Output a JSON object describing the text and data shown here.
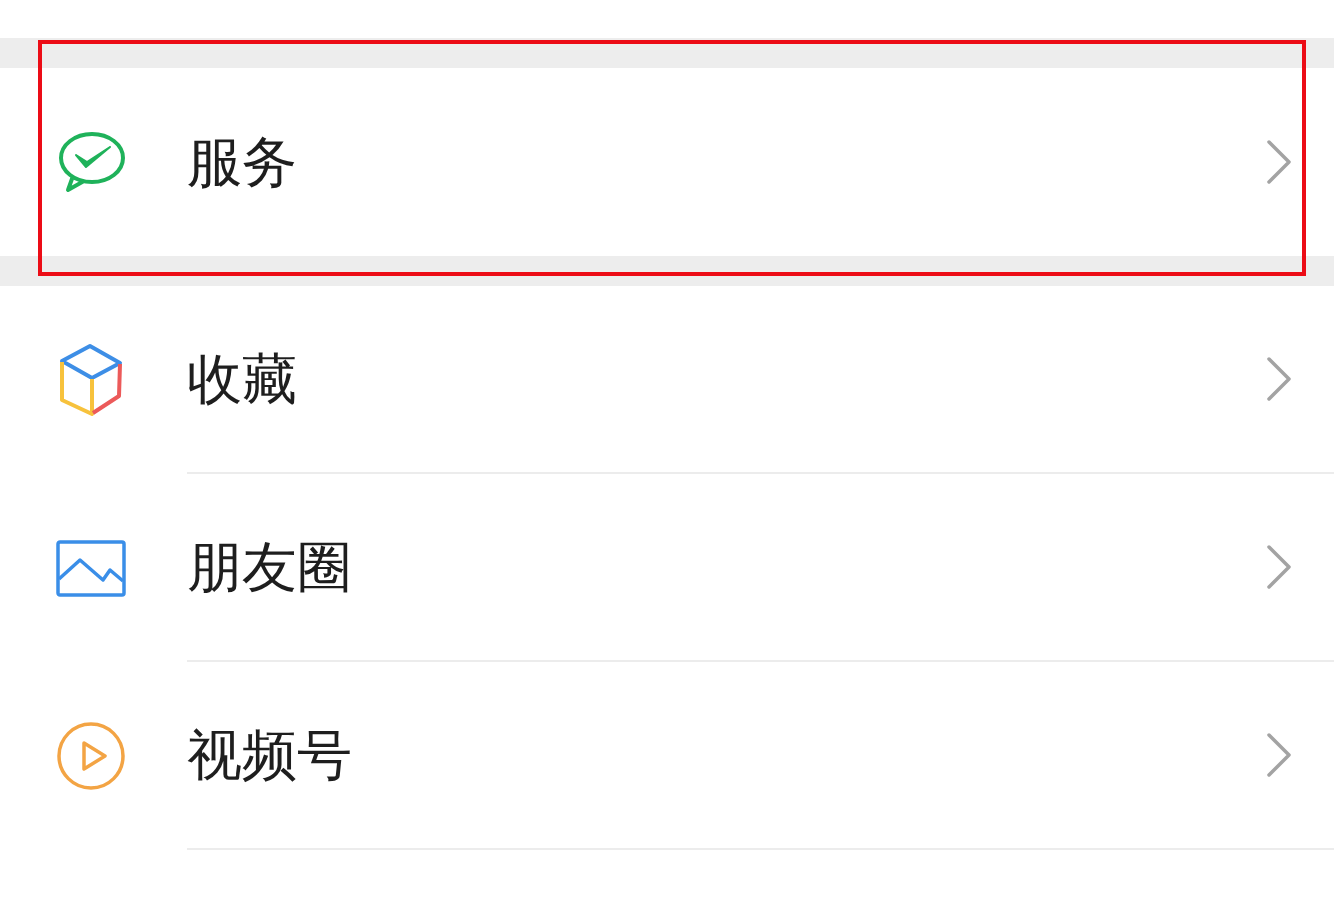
{
  "sections": [
    {
      "items": [
        {
          "kind": "service",
          "label": "服务",
          "highlighted": true
        }
      ]
    },
    {
      "items": [
        {
          "kind": "favorites",
          "label": "收藏",
          "highlighted": false
        },
        {
          "kind": "moments",
          "label": "朋友圈",
          "highlighted": false
        },
        {
          "kind": "channels",
          "label": "视频号",
          "highlighted": false
        }
      ]
    }
  ]
}
